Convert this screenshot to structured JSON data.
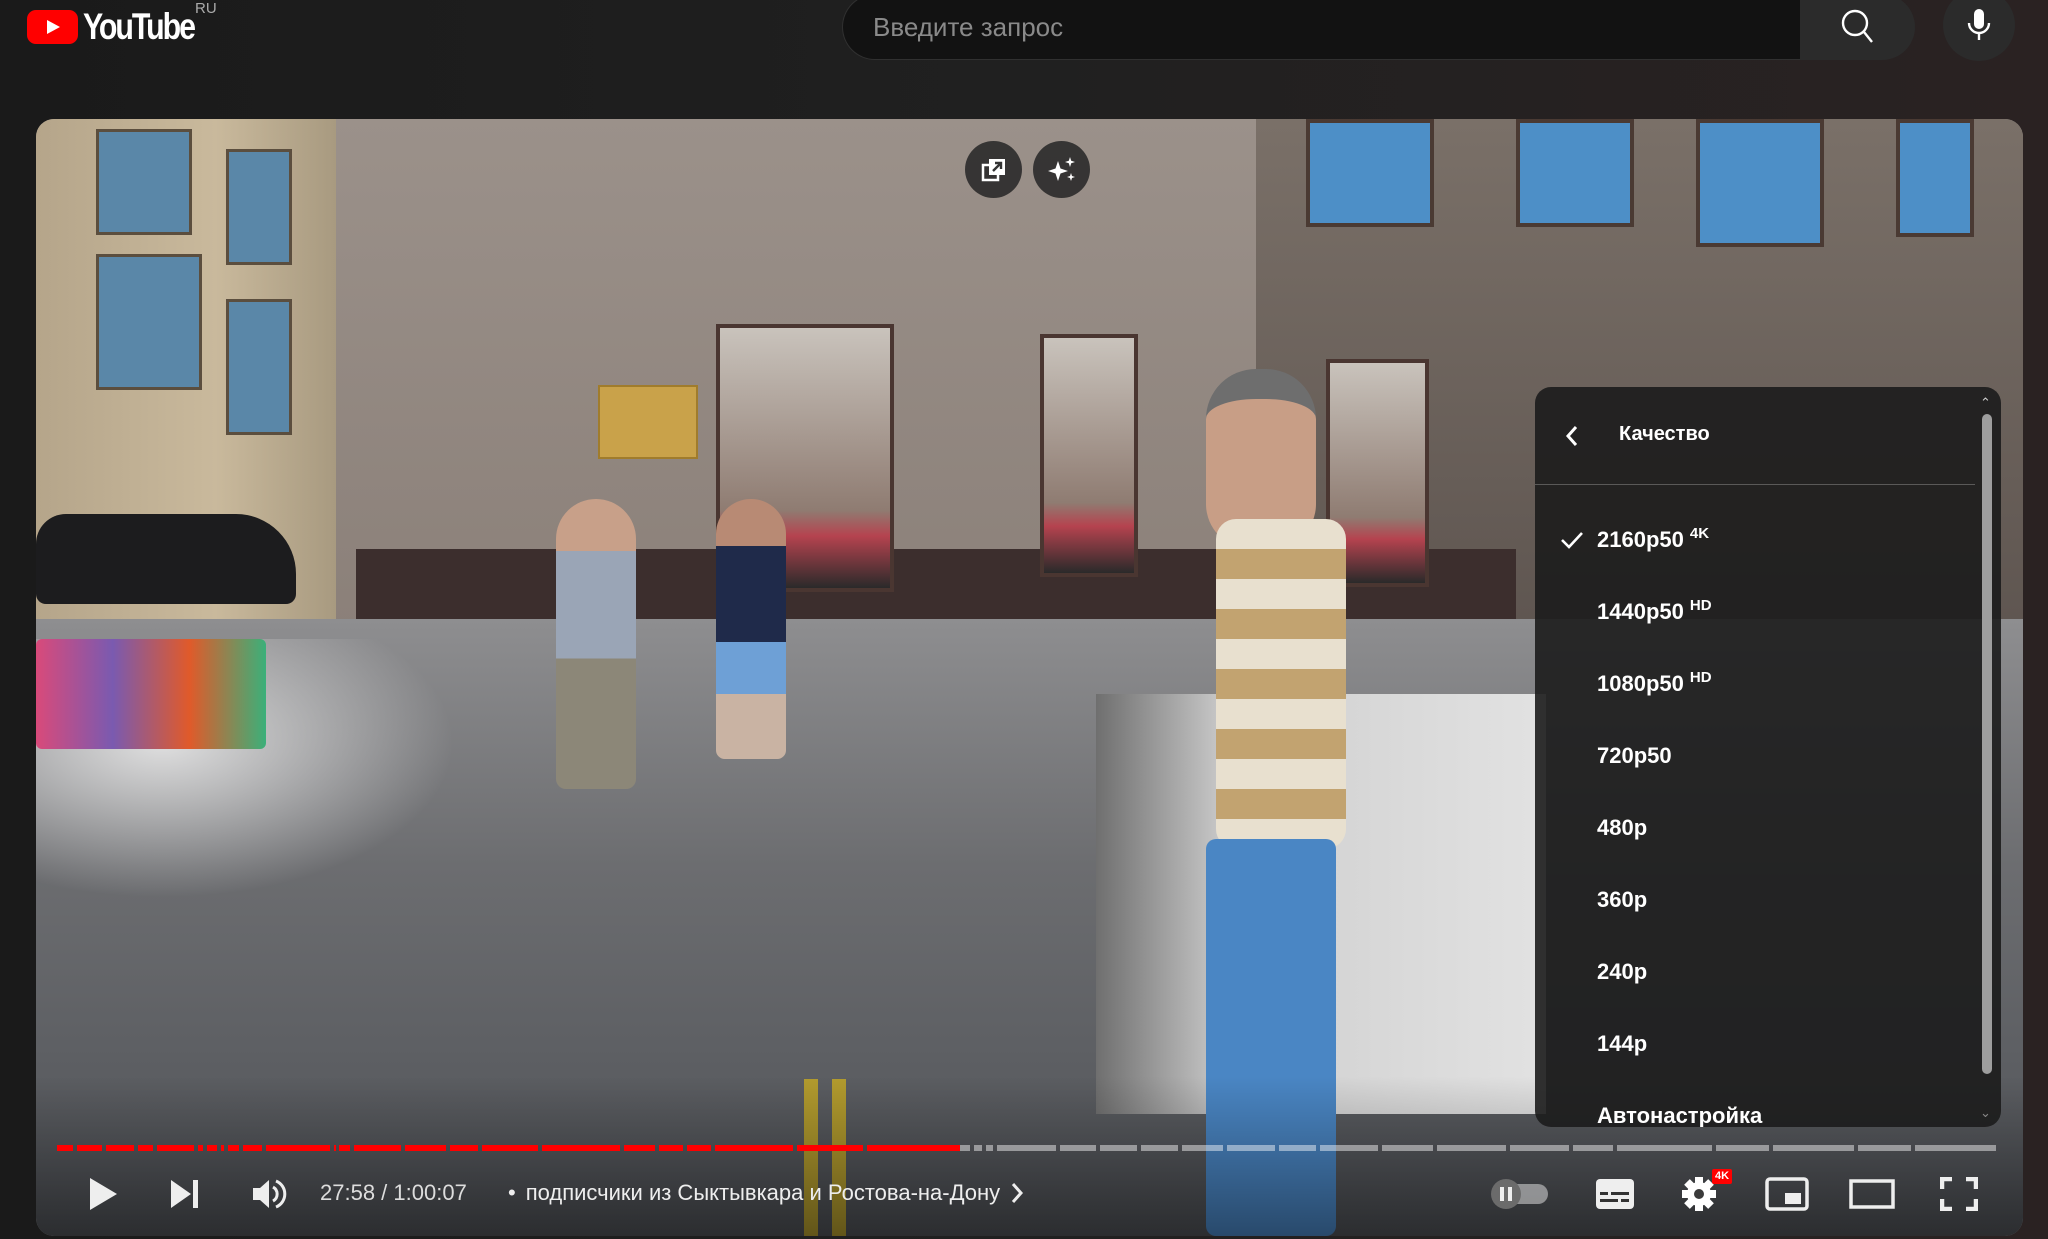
{
  "header": {
    "logo_text": "YouTube",
    "country_code": "RU",
    "search_placeholder": "Введите запрос",
    "search_value": "",
    "search_button_icon": "search-icon",
    "mic_button_icon": "microphone-icon"
  },
  "player": {
    "overlay_buttons": [
      {
        "name": "open-in-new-window",
        "icon": "external-window-icon"
      },
      {
        "name": "ai-assistant",
        "icon": "sparkles-icon"
      }
    ],
    "current_time": "27:58",
    "duration": "1:00:07",
    "time_display": "27:58 / 1:00:07",
    "chapter_separator": "•",
    "chapter_title": "подписчики из Сыктывкара и Ростова-на-Дону",
    "progress_fraction": 0.465,
    "chapters_boundaries_fraction": [
      0.0,
      0.0105,
      0.0254,
      0.0419,
      0.0517,
      0.0728,
      0.0774,
      0.0846,
      0.0882,
      0.0959,
      0.1077,
      0.1427,
      0.1453,
      0.153,
      0.1792,
      0.2024,
      0.2189,
      0.2494,
      0.2916,
      0.3097,
      0.3241,
      0.3385,
      0.3807,
      0.4167,
      0.4717,
      0.4779,
      0.4836,
      0.516,
      0.537,
      0.558,
      0.579,
      0.602,
      0.629,
      0.65,
      0.682,
      0.71,
      0.748,
      0.78,
      0.803,
      0.854,
      0.883,
      0.927,
      0.956,
      1.0
    ],
    "autoplay_enabled": false,
    "quality_badge": "4K",
    "accent_color": "#ff0000",
    "controls": {
      "play": "play-icon",
      "next": "next-icon",
      "volume": "volume-icon",
      "autoplay": "autoplay-toggle",
      "subtitles": "subtitles-icon",
      "settings": "gear-icon",
      "miniplayer": "miniplayer-icon",
      "theater": "theater-mode-icon",
      "fullscreen": "fullscreen-icon"
    }
  },
  "quality_menu": {
    "title": "Качество",
    "selected": "2160p50",
    "items": [
      {
        "label": "2160p50",
        "badge": "4K",
        "selected": true
      },
      {
        "label": "1440p50",
        "badge": "HD",
        "selected": false
      },
      {
        "label": "1080p50",
        "badge": "HD",
        "selected": false
      },
      {
        "label": "720p50",
        "badge": "",
        "selected": false
      },
      {
        "label": "480p",
        "badge": "",
        "selected": false
      },
      {
        "label": "360p",
        "badge": "",
        "selected": false
      },
      {
        "label": "240p",
        "badge": "",
        "selected": false
      },
      {
        "label": "144p",
        "badge": "",
        "selected": false
      },
      {
        "label": "Автонастройка",
        "badge": "",
        "selected": false
      }
    ]
  }
}
